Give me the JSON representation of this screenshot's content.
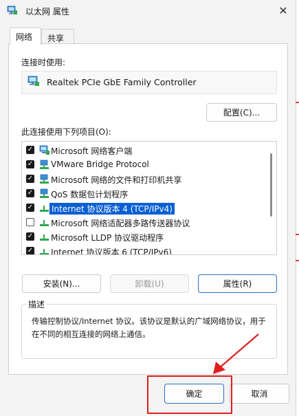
{
  "window": {
    "title": "以太网 属性",
    "close_glyph": "✕",
    "icon": "network-adapter-icon"
  },
  "tabs": [
    {
      "label": "网络",
      "active": true
    },
    {
      "label": "共享",
      "active": false
    }
  ],
  "connect_using_label": "连接时使用:",
  "adapter": {
    "name": "Realtek PCIe GbE Family Controller",
    "icon": "network-adapter-icon"
  },
  "configure_button": "配置(C)...",
  "items_label": "此连接使用下列项目(O):",
  "items": [
    {
      "label": "Microsoft 网络客户端",
      "checked": true,
      "icon": "network-client-icon",
      "selected": false
    },
    {
      "label": "VMware Bridge Protocol",
      "checked": true,
      "icon": "network-service-icon",
      "selected": false
    },
    {
      "label": "Microsoft 网络的文件和打印机共享",
      "checked": true,
      "icon": "network-service-icon",
      "selected": false
    },
    {
      "label": "QoS 数据包计划程序",
      "checked": true,
      "icon": "network-service-icon",
      "selected": false
    },
    {
      "label": "Internet 协议版本 4 (TCP/IPv4)",
      "checked": true,
      "icon": "protocol-icon",
      "selected": true
    },
    {
      "label": "Microsoft 网络适配器多路传送器协议",
      "checked": false,
      "icon": "protocol-icon",
      "selected": false
    },
    {
      "label": "Microsoft LLDP 协议驱动程序",
      "checked": true,
      "icon": "protocol-icon",
      "selected": false
    },
    {
      "label": "Internet 协议版本 6 (TCP/IPv6)",
      "checked": true,
      "icon": "protocol-icon",
      "selected": false
    }
  ],
  "buttons": {
    "install": "安装(N)...",
    "uninstall": "卸载(U)",
    "properties": "属性(R)",
    "ok": "确定",
    "cancel": "取消"
  },
  "description": {
    "title": "描述",
    "text": "传输控制协议/Internet 协议。该协议是默认的广域网络协议，用于在不同的相互连接的网络上通信。"
  },
  "colors": {
    "selection": "#0a5fd3",
    "focus_border": "#2b6fc5",
    "annotation_red": "#e01e1e"
  }
}
